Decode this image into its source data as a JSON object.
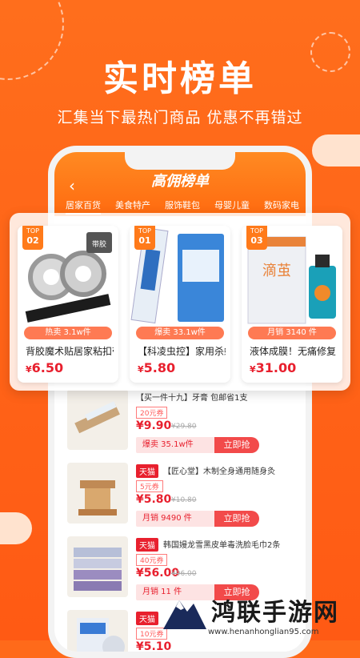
{
  "promo": {
    "headline": "实时榜单",
    "subline": "汇集当下最热门商品  优惠不再错过"
  },
  "phone": {
    "title": "高佣榜单",
    "tabs": [
      "居家百货",
      "美食特产",
      "服饰鞋包",
      "母婴儿童",
      "数码家电"
    ]
  },
  "top_cards": [
    {
      "rank_prefix": "TOP",
      "rank": "02",
      "sales": "热卖 3.1w件",
      "title": "背胶魔术贴居家粘扣带",
      "price_symbol": "¥",
      "price": "6.50",
      "img_label": "带胶"
    },
    {
      "rank_prefix": "TOP",
      "rank": "01",
      "sales": "爆卖 33.1w件",
      "title": "【科凌虫控】家用杀蟑胶饵",
      "price_symbol": "¥",
      "price": "5.80",
      "img_label": ""
    },
    {
      "rank_prefix": "TOP",
      "rank": "03",
      "sales": "月销 3140 件",
      "title": "液体成膜！无痛修复",
      "price_symbol": "¥",
      "price": "31.00",
      "img_label": "滴茧"
    }
  ],
  "list_items": [
    {
      "badge": "",
      "title": "【买一件十九】牙膏 包邮省1支",
      "coupon": "20元券",
      "price": "¥9.90",
      "orig": "¥29.80",
      "sold": "爆卖 35.1w件",
      "buy": "立即抢"
    },
    {
      "badge": "天猫",
      "title": "【匠心堂】木制全身通用随身灸",
      "coupon": "5元券",
      "price": "¥5.80",
      "orig": "¥10.80",
      "sold": "月销 9490 件",
      "buy": "立即抢"
    },
    {
      "badge": "天猫",
      "title": "韩国嫚龙雪黑皮单毒洗脸毛巾2条",
      "coupon": "40元券",
      "price": "¥56.00",
      "orig": "¥96.00",
      "sold": "月销 11 件",
      "buy": "立即抢"
    },
    {
      "badge": "天猫",
      "title": "",
      "coupon": "10元券",
      "price": "¥5.10",
      "orig": "",
      "sold": "",
      "buy": ""
    }
  ],
  "watermark": {
    "text": "鸿联手游网",
    "url": "www.henanhonglian95.com"
  },
  "colors": {
    "brand_orange": "#ff6a1a",
    "price_red": "#e8202e",
    "buy_button": "#f24a4a"
  }
}
